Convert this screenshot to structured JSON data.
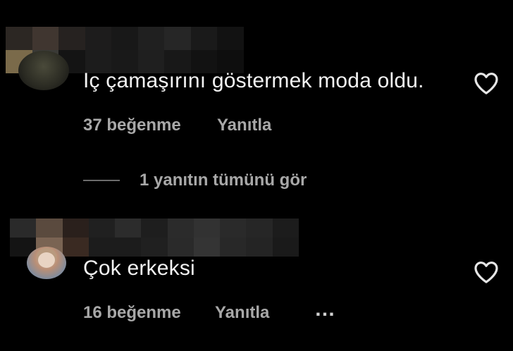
{
  "comments": [
    {
      "text": "Iç çamaşırını göstermek moda oldu.",
      "likes": "37 beğenme",
      "reply_label": "Yanıtla",
      "view_replies": "1 yanıtın tümünü gör",
      "username_blur_colors": [
        "#2c2723",
        "#403630",
        "#262220",
        "#1d1c1c",
        "#181818",
        "#202020",
        "#262626",
        "#1a1a1a",
        "#121212",
        "#7a6a4a",
        "#3a3a36",
        "#141414",
        "#1c1c1c",
        "#191919",
        "#1f1f1f",
        "#181818",
        "#121212",
        "#0e0e0e"
      ]
    },
    {
      "text": "Çok erkeksi",
      "likes": "16 beğenme",
      "reply_label": "Yanıtla",
      "more_icon": "…",
      "username_blur_colors": [
        "#2a2a2a",
        "#5a4a3e",
        "#2a201c",
        "#202020",
        "#2c2c2c",
        "#1e1e1e",
        "#2b2b2b",
        "#323232",
        "#2a2a2a",
        "#262626",
        "#1c1c1c",
        "#141414",
        "#7a6453",
        "#3a2a22",
        "#1c1c1c",
        "#1c1c1c",
        "#202020",
        "#2a2a2a",
        "#343434",
        "#282828",
        "#242424",
        "#1a1a1a"
      ]
    }
  ],
  "icons": {
    "like": "heart-outline-icon",
    "more": "ellipsis-icon"
  },
  "colors": {
    "background": "#000000",
    "primary_text": "#f3f3f3",
    "secondary_text": "#a8a8a8"
  }
}
